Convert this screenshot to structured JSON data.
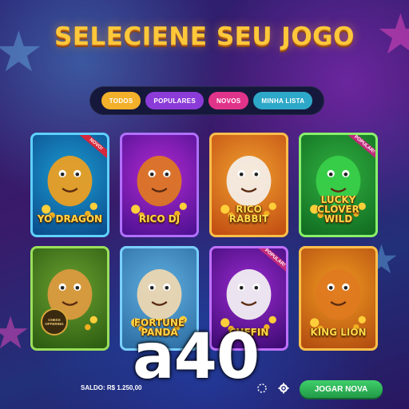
{
  "title": "SELECIENE SEU JOGO",
  "filters": [
    {
      "label": "TODOS"
    },
    {
      "label": "POPULARES"
    },
    {
      "label": "NOVOS"
    },
    {
      "label": "MINHA LISTA"
    }
  ],
  "games": [
    {
      "name": "YO DRAGON",
      "ribbon": "NOVO!",
      "colors": {
        "a": "#1c9ad0",
        "b": "#0a4a8a",
        "border": "#5fd0ff",
        "art": "#f0a020"
      }
    },
    {
      "name": "RICO DJ",
      "ribbon": "",
      "colors": {
        "a": "#b02ad0",
        "b": "#4a1090",
        "border": "#b070ff",
        "art": "#e07a20"
      }
    },
    {
      "name": "RICO RABBIT",
      "ribbon": "",
      "colors": {
        "a": "#f0a030",
        "b": "#c04a10",
        "border": "#ffbe4a",
        "art": "#f4f0ea"
      }
    },
    {
      "name": "LUCKY CLOVER WILD",
      "ribbon": "POPULAR!",
      "colors": {
        "a": "#30b040",
        "b": "#106a20",
        "border": "#8af06a",
        "art": "#3ad04a"
      }
    },
    {
      "name": "",
      "ribbon": "",
      "badge": "CHESS OFFERING",
      "colors": {
        "a": "#6aa030",
        "b": "#2a5a10",
        "border": "#9ae05a",
        "art": "#e09a40"
      }
    },
    {
      "name": "FORTUNE PANDA",
      "ribbon": "",
      "colors": {
        "a": "#60b0e0",
        "b": "#2a6aa0",
        "border": "#7ad0ff",
        "art": "#f0d8b0"
      }
    },
    {
      "name": "CHEFIN",
      "ribbon": "POPULAR!",
      "colors": {
        "a": "#9a2ad0",
        "b": "#3a0a70",
        "border": "#c070ff",
        "art": "#f4f4f4"
      }
    },
    {
      "name": "KING LION",
      "ribbon": "",
      "colors": {
        "a": "#f09a20",
        "b": "#b04a10",
        "border": "#ffc04a",
        "art": "#e07a20"
      }
    }
  ],
  "footer": {
    "balance": "SALDO: R$ 1.250,00",
    "play_label": "JOGAR NOVA"
  },
  "watermark": "a40",
  "icons": {
    "settings": "gear-icon",
    "sound": "sound-icon"
  }
}
